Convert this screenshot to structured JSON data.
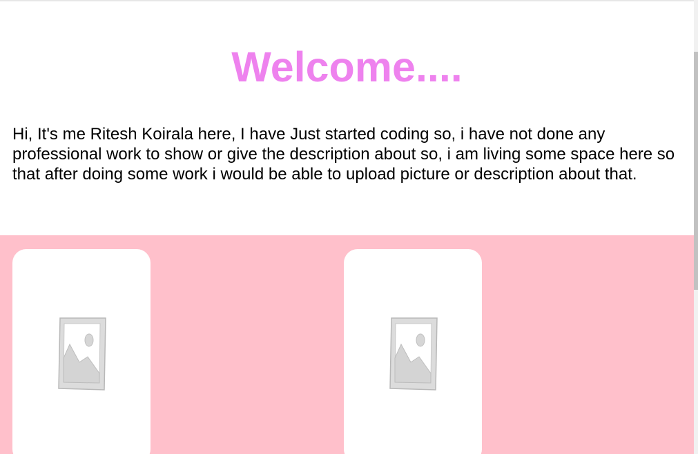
{
  "header": {
    "title": "Welcome...."
  },
  "intro": {
    "text": "Hi, It's me Ritesh Koirala here, I have Just started coding so, i have not done any professional work to show or give the description about so, i am living some space here so that after doing some work i would be able to upload picture or description about that."
  },
  "gallery": {
    "background": "#ffc0cb",
    "cards": [
      {
        "image_icon": "image-placeholder-icon"
      },
      {
        "image_icon": "image-placeholder-icon"
      }
    ]
  },
  "colors": {
    "title": "#ee82ee",
    "text": "#000000",
    "card": "#ffffff"
  }
}
